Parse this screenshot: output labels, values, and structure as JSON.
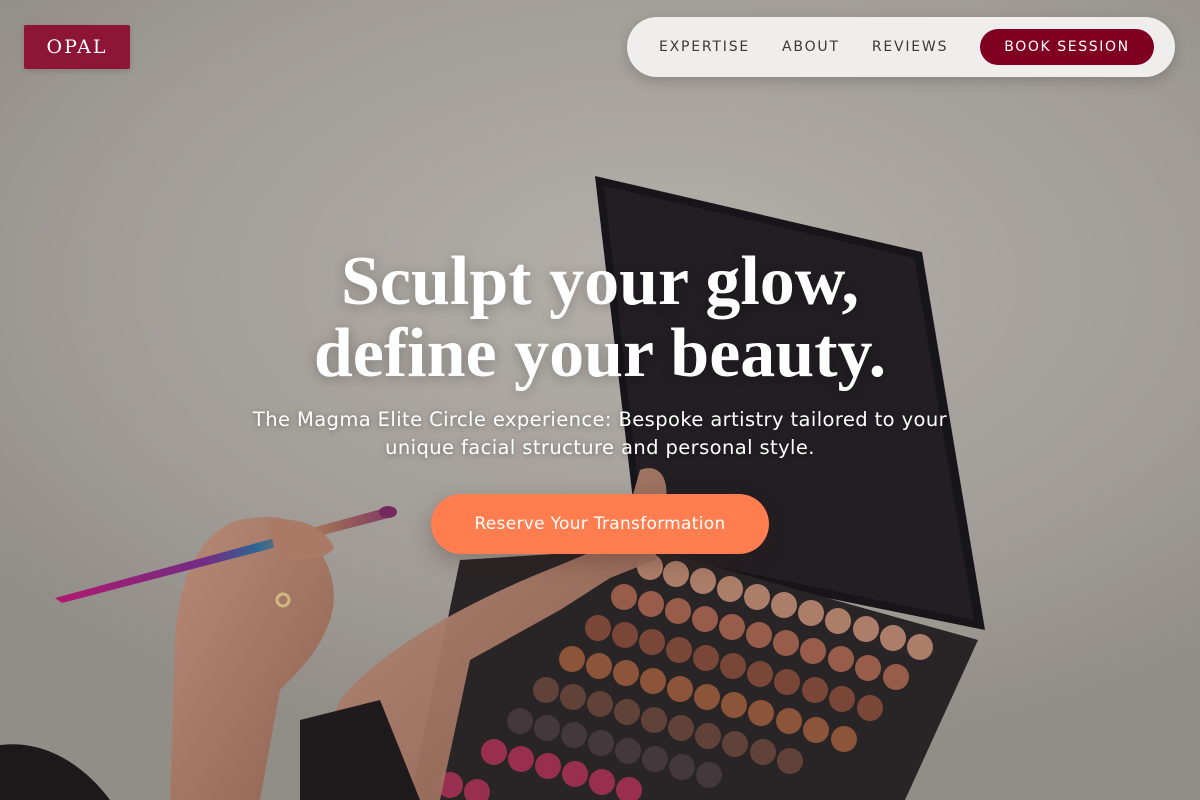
{
  "brand": {
    "logo_text": "OPAL",
    "primary_color": "#800021",
    "accent_color": "#ff7d4e"
  },
  "nav": {
    "links": [
      {
        "label": "EXPERTISE"
      },
      {
        "label": "ABOUT"
      },
      {
        "label": "REVIEWS"
      }
    ],
    "book_label": "BOOK SESSION"
  },
  "hero": {
    "headline_line1": "Sculpt your glow,",
    "headline_line2": "define your beauty.",
    "subtext": "The Magma Elite Circle experience: Bespoke artistry tailored to your unique facial structure and personal style.",
    "cta_label": "Reserve Your Transformation",
    "background_image": "hand-holding-makeup-brush-and-eyeshadow-palette-photo"
  }
}
